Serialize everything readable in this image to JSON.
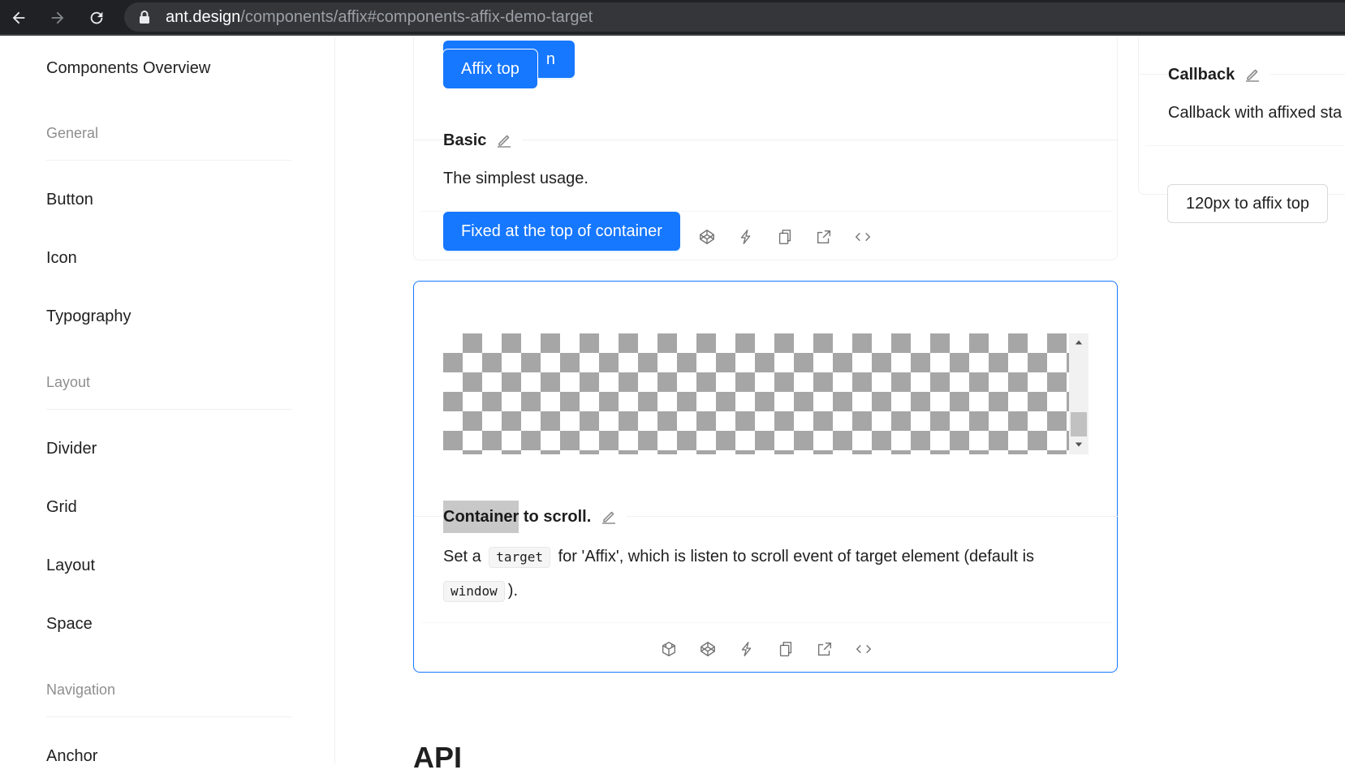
{
  "browser": {
    "url_host": "ant.design",
    "url_path": "/components/affix#components-affix-demo-target"
  },
  "sidebar": {
    "overview": "Components Overview",
    "groups": {
      "general": "General",
      "layout": "Layout",
      "navigation": "Navigation"
    },
    "items": {
      "button": "Button",
      "icon": "Icon",
      "typography": "Typography",
      "divider": "Divider",
      "grid": "Grid",
      "layout": "Layout",
      "space": "Space",
      "anchor": "Anchor"
    }
  },
  "basic_demo": {
    "affix_top_label": "Affix top",
    "affix_bottom_partial": "n",
    "title": "Basic",
    "description": "The simplest usage.",
    "fixed_button_label": "Fixed at the top of container"
  },
  "target_demo": {
    "title_highlight": "Container",
    "title_rest": " to scroll.",
    "desc_part1": "Set a ",
    "code_target": "target",
    "desc_part2": " for 'Affix', which is listen to scroll event of target element (default is ",
    "code_window": "window",
    "desc_part3": ")."
  },
  "callback_demo": {
    "title": "Callback",
    "description": "Callback with affixed sta",
    "button_label": "120px to affix top"
  },
  "api_heading": "API",
  "colors": {
    "primary": "#1677ff",
    "chrome_bg": "#202124",
    "checker": "#a6a6a6"
  },
  "icons": {
    "back": "arrow-left-icon",
    "forward": "arrow-right-icon",
    "reload": "reload-icon",
    "lock": "lock-icon",
    "edit": "edit-icon",
    "codesandbox": "codesandbox-icon",
    "codepen": "codepen-icon",
    "stackblitz": "thunderbolt-icon",
    "copy": "copy-icon",
    "open": "external-link-icon",
    "code": "code-icon"
  }
}
